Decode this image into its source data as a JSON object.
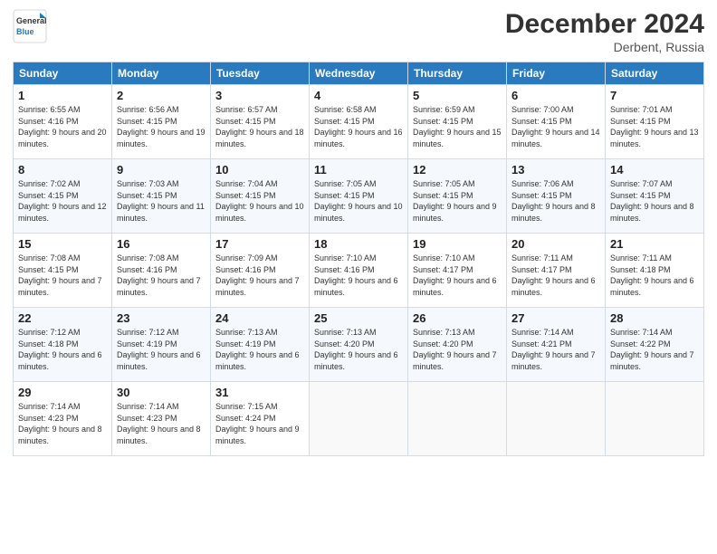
{
  "header": {
    "logo": {
      "general": "General",
      "blue": "Blue"
    },
    "title": "December 2024",
    "location": "Derbent, Russia"
  },
  "weekdays": [
    "Sunday",
    "Monday",
    "Tuesday",
    "Wednesday",
    "Thursday",
    "Friday",
    "Saturday"
  ],
  "weeks": [
    [
      {
        "day": "1",
        "sunrise": "6:55 AM",
        "sunset": "4:16 PM",
        "daylight": "9 hours and 20 minutes."
      },
      {
        "day": "2",
        "sunrise": "6:56 AM",
        "sunset": "4:15 PM",
        "daylight": "9 hours and 19 minutes."
      },
      {
        "day": "3",
        "sunrise": "6:57 AM",
        "sunset": "4:15 PM",
        "daylight": "9 hours and 18 minutes."
      },
      {
        "day": "4",
        "sunrise": "6:58 AM",
        "sunset": "4:15 PM",
        "daylight": "9 hours and 16 minutes."
      },
      {
        "day": "5",
        "sunrise": "6:59 AM",
        "sunset": "4:15 PM",
        "daylight": "9 hours and 15 minutes."
      },
      {
        "day": "6",
        "sunrise": "7:00 AM",
        "sunset": "4:15 PM",
        "daylight": "9 hours and 14 minutes."
      },
      {
        "day": "7",
        "sunrise": "7:01 AM",
        "sunset": "4:15 PM",
        "daylight": "9 hours and 13 minutes."
      }
    ],
    [
      {
        "day": "8",
        "sunrise": "7:02 AM",
        "sunset": "4:15 PM",
        "daylight": "9 hours and 12 minutes."
      },
      {
        "day": "9",
        "sunrise": "7:03 AM",
        "sunset": "4:15 PM",
        "daylight": "9 hours and 11 minutes."
      },
      {
        "day": "10",
        "sunrise": "7:04 AM",
        "sunset": "4:15 PM",
        "daylight": "9 hours and 10 minutes."
      },
      {
        "day": "11",
        "sunrise": "7:05 AM",
        "sunset": "4:15 PM",
        "daylight": "9 hours and 10 minutes."
      },
      {
        "day": "12",
        "sunrise": "7:05 AM",
        "sunset": "4:15 PM",
        "daylight": "9 hours and 9 minutes."
      },
      {
        "day": "13",
        "sunrise": "7:06 AM",
        "sunset": "4:15 PM",
        "daylight": "9 hours and 8 minutes."
      },
      {
        "day": "14",
        "sunrise": "7:07 AM",
        "sunset": "4:15 PM",
        "daylight": "9 hours and 8 minutes."
      }
    ],
    [
      {
        "day": "15",
        "sunrise": "7:08 AM",
        "sunset": "4:15 PM",
        "daylight": "9 hours and 7 minutes."
      },
      {
        "day": "16",
        "sunrise": "7:08 AM",
        "sunset": "4:16 PM",
        "daylight": "9 hours and 7 minutes."
      },
      {
        "day": "17",
        "sunrise": "7:09 AM",
        "sunset": "4:16 PM",
        "daylight": "9 hours and 7 minutes."
      },
      {
        "day": "18",
        "sunrise": "7:10 AM",
        "sunset": "4:16 PM",
        "daylight": "9 hours and 6 minutes."
      },
      {
        "day": "19",
        "sunrise": "7:10 AM",
        "sunset": "4:17 PM",
        "daylight": "9 hours and 6 minutes."
      },
      {
        "day": "20",
        "sunrise": "7:11 AM",
        "sunset": "4:17 PM",
        "daylight": "9 hours and 6 minutes."
      },
      {
        "day": "21",
        "sunrise": "7:11 AM",
        "sunset": "4:18 PM",
        "daylight": "9 hours and 6 minutes."
      }
    ],
    [
      {
        "day": "22",
        "sunrise": "7:12 AM",
        "sunset": "4:18 PM",
        "daylight": "9 hours and 6 minutes."
      },
      {
        "day": "23",
        "sunrise": "7:12 AM",
        "sunset": "4:19 PM",
        "daylight": "9 hours and 6 minutes."
      },
      {
        "day": "24",
        "sunrise": "7:13 AM",
        "sunset": "4:19 PM",
        "daylight": "9 hours and 6 minutes."
      },
      {
        "day": "25",
        "sunrise": "7:13 AM",
        "sunset": "4:20 PM",
        "daylight": "9 hours and 6 minutes."
      },
      {
        "day": "26",
        "sunrise": "7:13 AM",
        "sunset": "4:20 PM",
        "daylight": "9 hours and 7 minutes."
      },
      {
        "day": "27",
        "sunrise": "7:14 AM",
        "sunset": "4:21 PM",
        "daylight": "9 hours and 7 minutes."
      },
      {
        "day": "28",
        "sunrise": "7:14 AM",
        "sunset": "4:22 PM",
        "daylight": "9 hours and 7 minutes."
      }
    ],
    [
      {
        "day": "29",
        "sunrise": "7:14 AM",
        "sunset": "4:23 PM",
        "daylight": "9 hours and 8 minutes."
      },
      {
        "day": "30",
        "sunrise": "7:14 AM",
        "sunset": "4:23 PM",
        "daylight": "9 hours and 8 minutes."
      },
      {
        "day": "31",
        "sunrise": "7:15 AM",
        "sunset": "4:24 PM",
        "daylight": "9 hours and 9 minutes."
      },
      null,
      null,
      null,
      null
    ]
  ],
  "labels": {
    "sunrise": "Sunrise:",
    "sunset": "Sunset:",
    "daylight": "Daylight:"
  }
}
